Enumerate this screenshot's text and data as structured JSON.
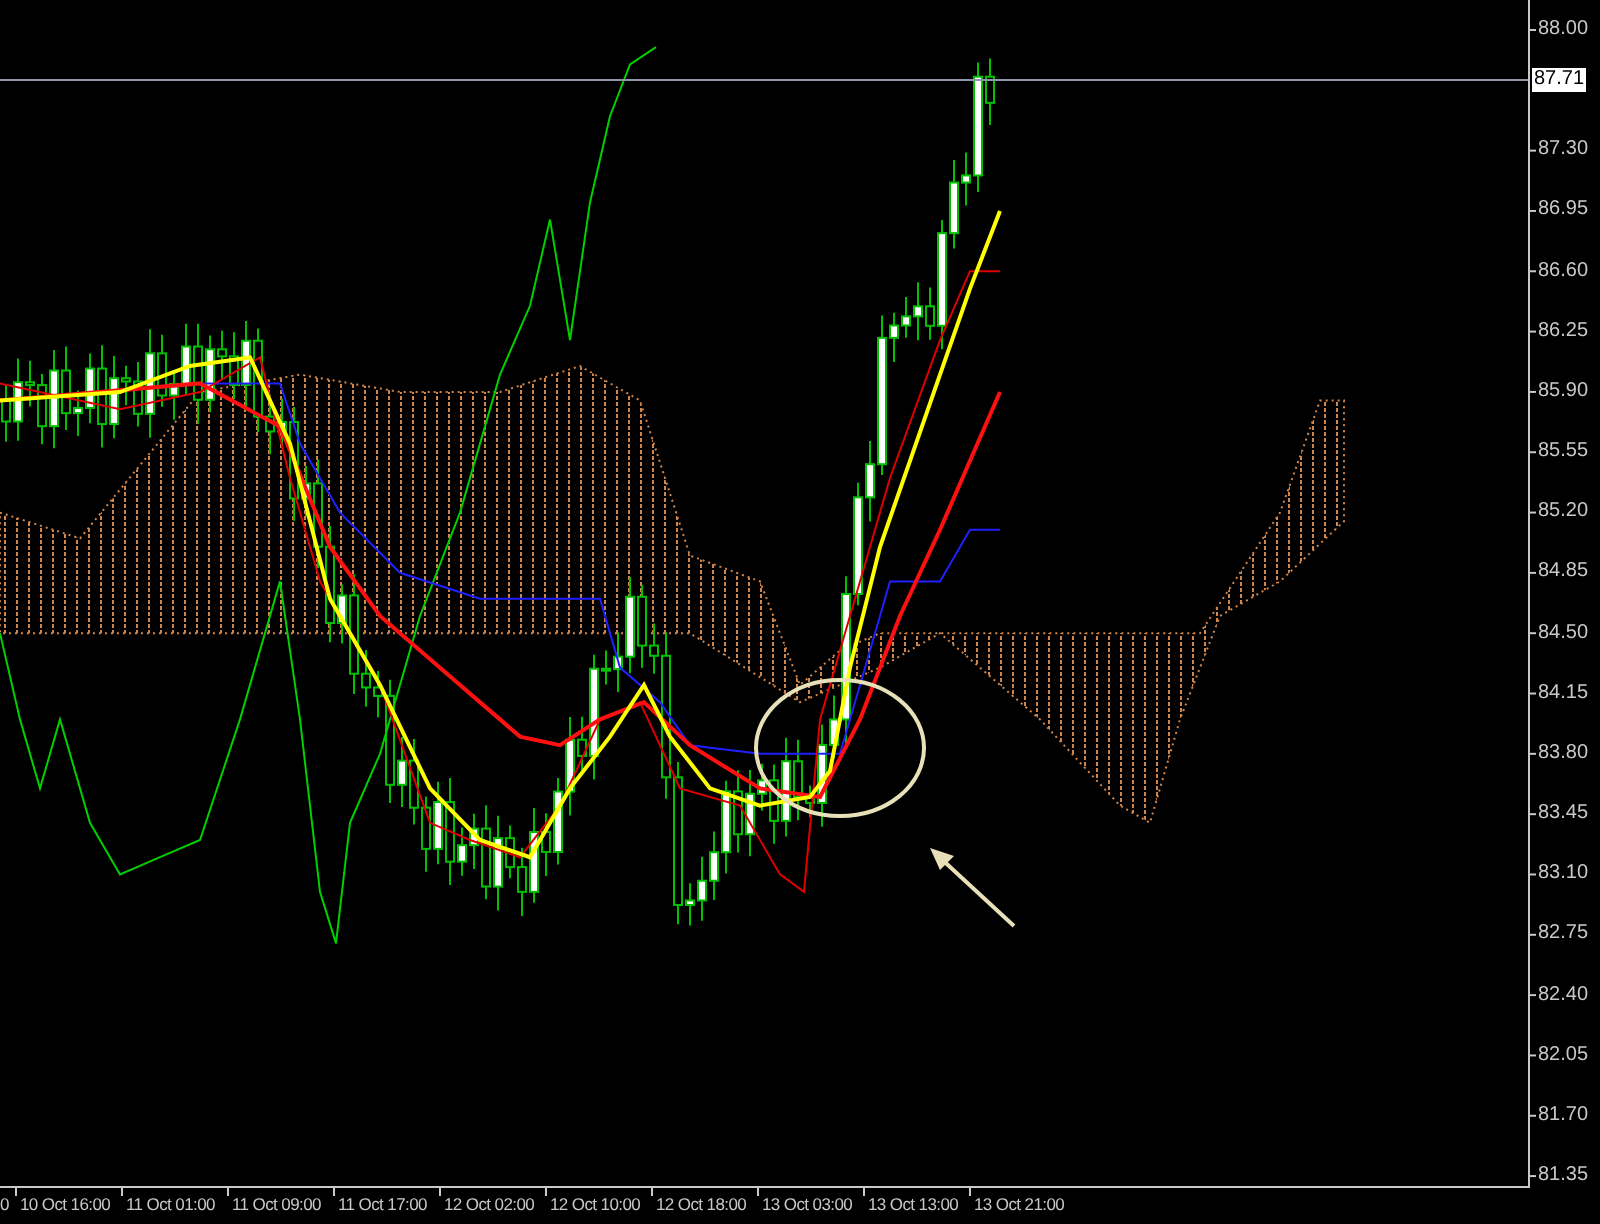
{
  "price_axis": {
    "labels": [
      "88.00",
      "87.30",
      "86.95",
      "86.60",
      "86.25",
      "85.90",
      "85.55",
      "85.20",
      "84.85",
      "84.50",
      "84.15",
      "83.80",
      "83.45",
      "83.10",
      "82.75",
      "82.40",
      "82.05",
      "81.70",
      "81.35"
    ]
  },
  "current_price": "87.71",
  "time_axis": {
    "labels": [
      "0",
      "10 Oct 16:00",
      "11 Oct 01:00",
      "11 Oct 09:00",
      "11 Oct 17:00",
      "12 Oct 02:00",
      "12 Oct 10:00",
      "12 Oct 18:00",
      "13 Oct 03:00",
      "13 Oct 13:00",
      "13 Oct 21:00"
    ]
  }
}
